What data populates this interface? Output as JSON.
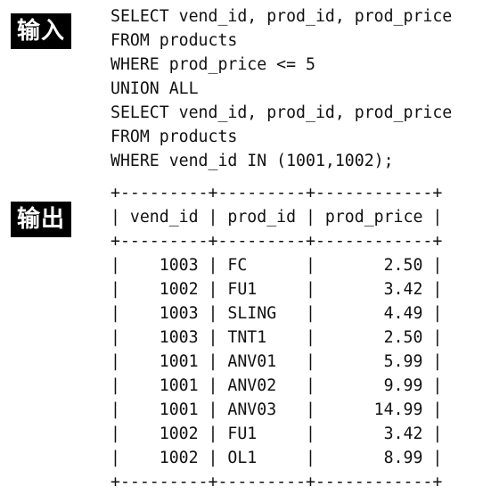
{
  "input_label": "输入",
  "output_label": "输出",
  "query_lines": [
    "SELECT vend_id, prod_id, prod_price",
    "FROM products",
    "WHERE prod_price <= 5",
    "UNION ALL",
    "SELECT vend_id, prod_id, prod_price",
    "FROM products",
    "WHERE vend_id IN (1001,1002);"
  ],
  "result_lines": [
    "+---------+---------+------------+",
    "| vend_id | prod_id | prod_price |",
    "+---------+---------+------------+",
    "|    1003 | FC      |       2.50 |",
    "|    1002 | FU1     |       3.42 |",
    "|    1003 | SLING   |       4.49 |",
    "|    1003 | TNT1    |       2.50 |",
    "|    1001 | ANV01   |       5.99 |",
    "|    1001 | ANV02   |       9.99 |",
    "|    1001 | ANV03   |      14.99 |",
    "|    1002 | FU1     |       3.42 |",
    "|    1002 | OL1     |       8.99 |",
    "+---------+---------+------------+"
  ]
}
